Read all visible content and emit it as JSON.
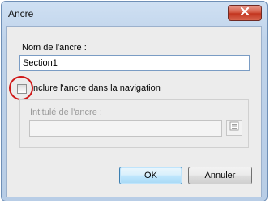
{
  "window": {
    "title": "Ancre",
    "close_icon": "close-icon"
  },
  "form": {
    "anchor_name_label": "Nom de l'ancre :",
    "anchor_name_value": "Section1",
    "include_checkbox_label": "Inclure l'ancre dans la navigation",
    "include_checked": false,
    "anchor_title_label": "Intitulé de l'ancre :",
    "anchor_title_value": "",
    "picker_icon": "list-icon"
  },
  "buttons": {
    "ok_label": "OK",
    "cancel_label": "Annuler"
  },
  "colors": {
    "annotation_circle": "#d01818",
    "close_button": "#c2351f"
  }
}
